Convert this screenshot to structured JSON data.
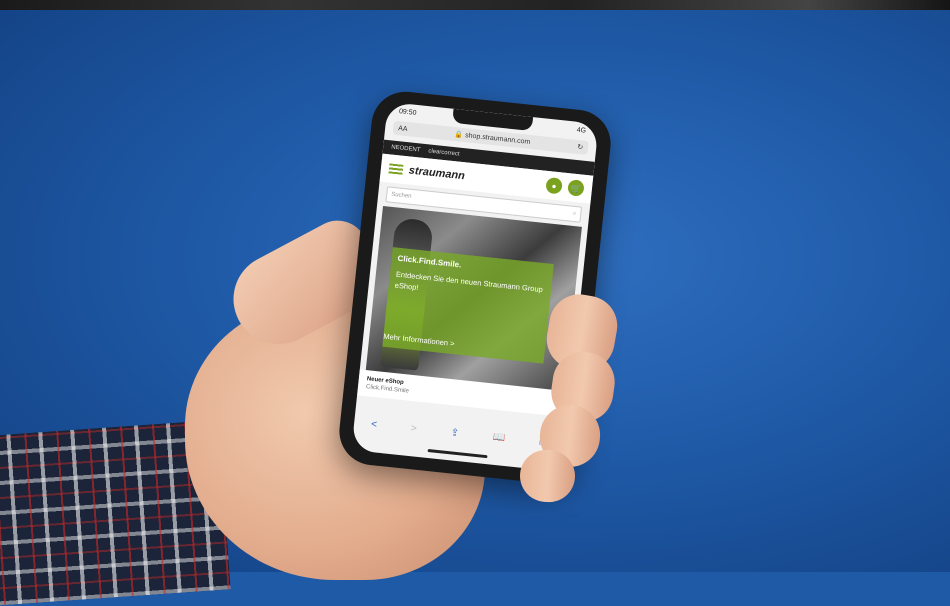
{
  "phone": {
    "status": {
      "time": "09:50",
      "signal": "4G"
    },
    "url_bar": {
      "text_size": "AA",
      "url": "shop.straumann.com",
      "reload_icon": "reload-icon"
    },
    "brands": [
      "NEODENT",
      "clearcorrect"
    ],
    "header": {
      "logo": "straumann",
      "account_icon": "user-icon",
      "cart_icon": "cart-icon"
    },
    "search": {
      "placeholder": "Suchen",
      "icon": "search-icon"
    },
    "hero": {
      "headline": "Click.Find.Smile.",
      "body": "Entdecken Sie den neuen Straumann Group eShop!",
      "cta": "Mehr Informationen >"
    },
    "caption": {
      "title": "Neuer eShop",
      "subtitle": "Click.Find.Smile"
    },
    "toolbar": {
      "back": "<",
      "forward": ">"
    }
  },
  "colors": {
    "background": "#1f5aa7",
    "brand_green": "#7aa21f"
  }
}
